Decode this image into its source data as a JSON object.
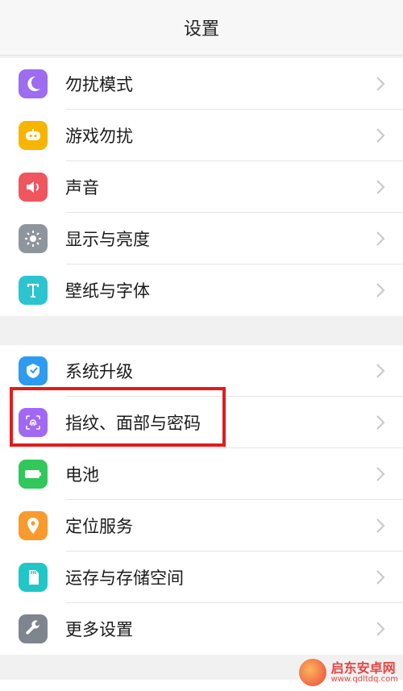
{
  "header": {
    "title": "设置"
  },
  "groups": [
    {
      "items": [
        {
          "label": "勿扰模式",
          "icon": "moon-icon",
          "color": "#9d6cf0"
        },
        {
          "label": "游戏勿扰",
          "icon": "game-controller-icon",
          "color": "#f7b500"
        },
        {
          "label": "声音",
          "icon": "speaker-icon",
          "color": "#f0565e"
        },
        {
          "label": "显示与亮度",
          "icon": "brightness-icon",
          "color": "#8f959d"
        },
        {
          "label": "壁纸与字体",
          "icon": "font-t-icon",
          "color": "#2cc4cf"
        }
      ]
    },
    {
      "items": [
        {
          "label": "系统升级",
          "icon": "system-update-icon",
          "color": "#2d9bf0"
        },
        {
          "label": "指纹、面部与密码",
          "icon": "fingerprint-icon",
          "color": "#a167f5"
        },
        {
          "label": "电池",
          "icon": "battery-icon",
          "color": "#30c85b"
        },
        {
          "label": "定位服务",
          "icon": "location-pin-icon",
          "color": "#f89a2c"
        },
        {
          "label": "运存与存储空间",
          "icon": "storage-icon",
          "color": "#21c6c6"
        },
        {
          "label": "更多设置",
          "icon": "wrench-icon",
          "color": "#7e858f"
        }
      ]
    }
  ],
  "watermark": {
    "name": "启东安卓网",
    "url": "www.qdltdq.com"
  },
  "colors": {
    "highlight": "#e41b1b",
    "chevron": "#c7c7cc"
  }
}
